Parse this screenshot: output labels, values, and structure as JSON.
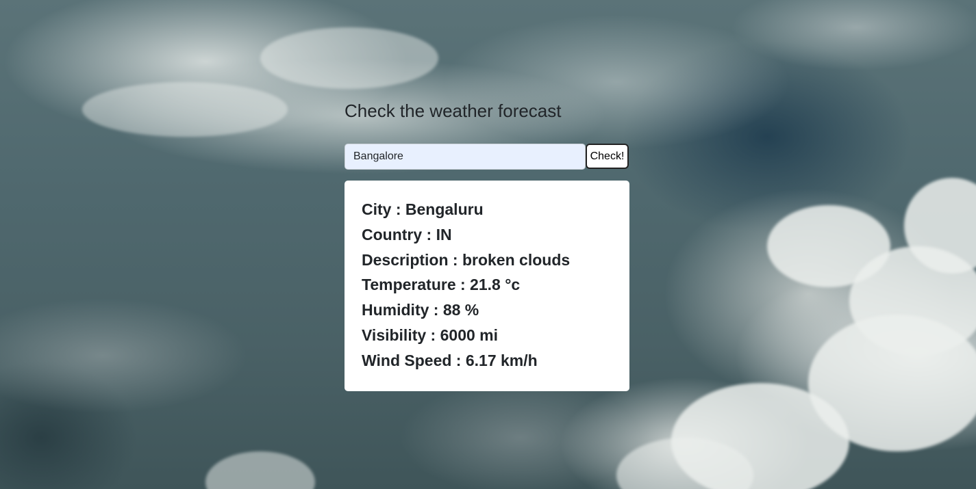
{
  "page": {
    "title": "Check the weather forecast"
  },
  "search": {
    "value": "Bangalore",
    "button_label": "Check!"
  },
  "result": {
    "city": "City : Bengaluru",
    "country": "Country : IN",
    "description": "Description : broken clouds",
    "temperature": "Temperature : 21.8 °c",
    "humidity": "Humidity : 88 %",
    "visibility": "Visibility : 6000 mi",
    "wind_speed": "Wind Speed : 6.17 km/h"
  },
  "colors": {
    "input_background": "#e8f0fe",
    "card_background": "#ffffff",
    "text": "#212529"
  }
}
